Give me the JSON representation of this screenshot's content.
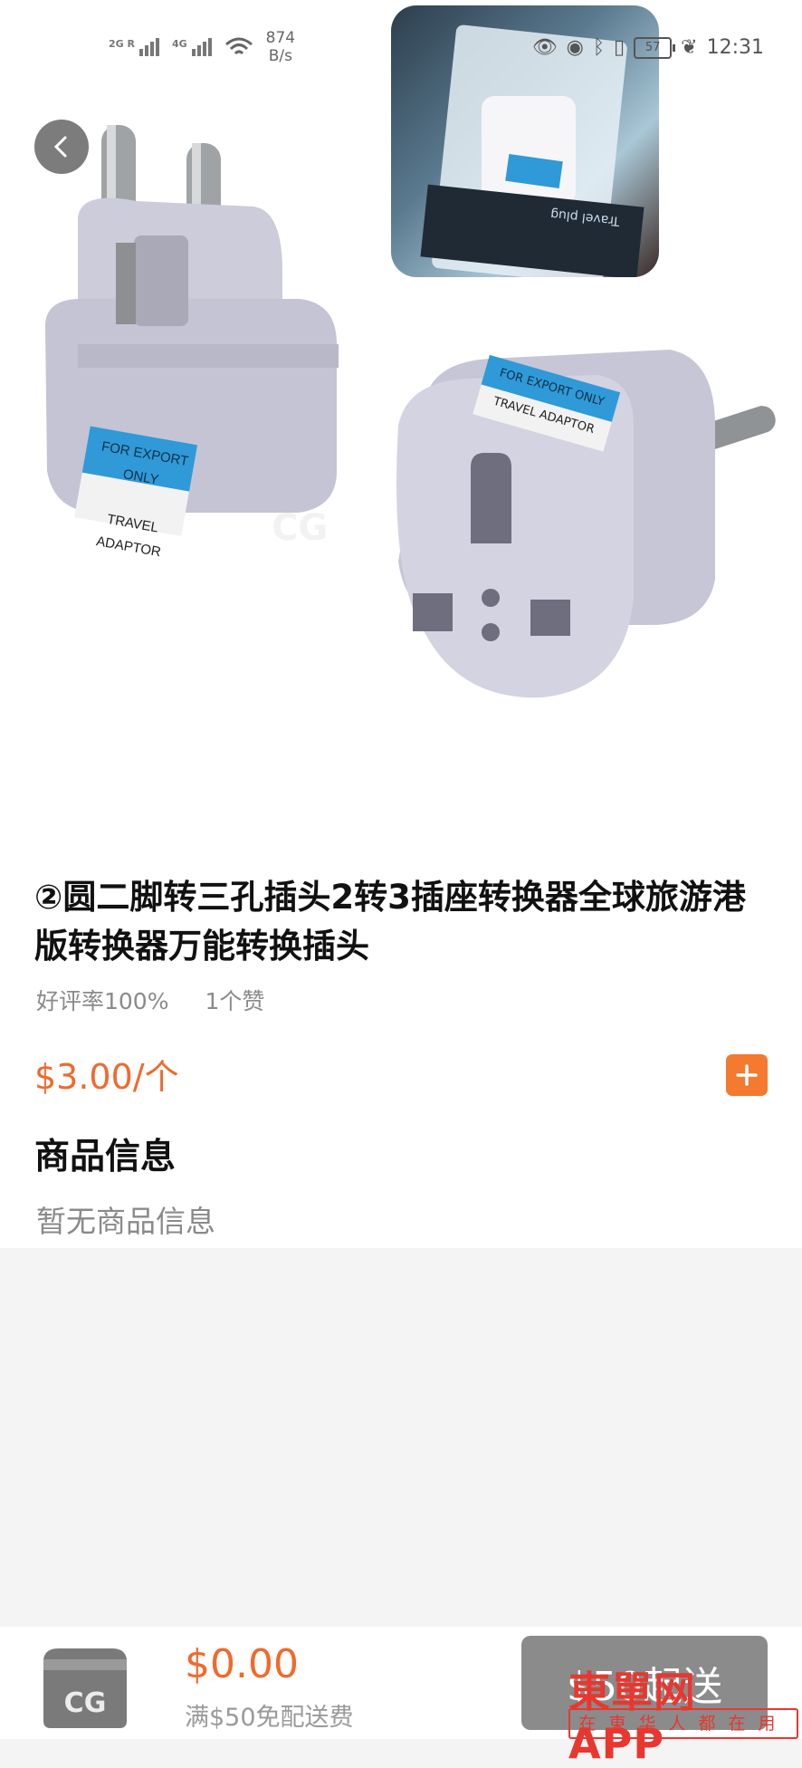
{
  "status_bar": {
    "network_1": "2G R",
    "network_2": "4G",
    "speed_value": "874",
    "speed_unit": "B/s",
    "battery": "57",
    "time": "12:31"
  },
  "hero": {
    "label_1": "FOR EXPORT ONLY",
    "label_2": "TRAVEL ADAPTOR",
    "thumb_text": "Travel plug"
  },
  "product": {
    "title": "②圆二脚转三孔插头2转3插座转换器全球旅游港版转换器万能转换插头",
    "rating": "好评率100%",
    "likes": "1个赞",
    "price": "$3.00/个"
  },
  "details": {
    "heading": "商品信息",
    "empty_text": "暂无商品信息"
  },
  "cart": {
    "total": "$0.00",
    "delivery_note": "满$50免配送费",
    "checkout_label": "$50起送"
  },
  "brand": {
    "name": "東單网APP",
    "slogan": "在東华人都在用"
  },
  "colors": {
    "accent": "#f06a2d",
    "brand_red": "#e8372f",
    "checkout_disabled": "#8b8b8b",
    "label_blue": "#2f9ad7"
  }
}
